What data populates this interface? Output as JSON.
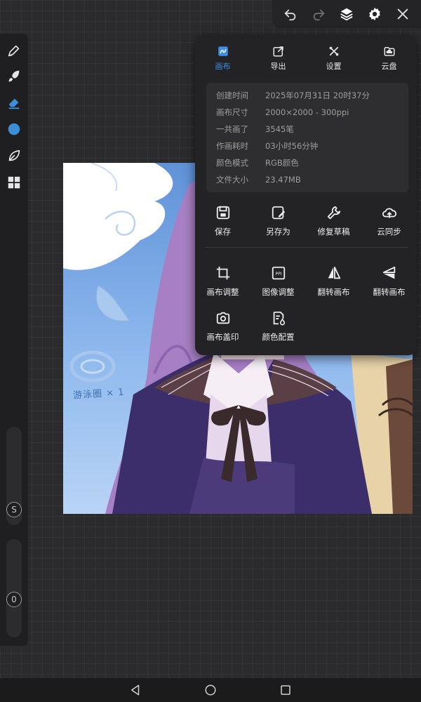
{
  "panel": {
    "tabs": [
      {
        "label": "画布",
        "icon": "canvas-icon",
        "active": true
      },
      {
        "label": "导出",
        "icon": "export-icon",
        "active": false
      },
      {
        "label": "设置",
        "icon": "settings-tools-icon",
        "active": false
      },
      {
        "label": "云盘",
        "icon": "cloud-drive-icon",
        "active": false
      }
    ],
    "info": [
      {
        "key": "创建时间",
        "value": "2025年07月31日 20时37分"
      },
      {
        "key": "画布尺寸",
        "value": "2000×2000 - 300ppi"
      },
      {
        "key": "一共画了",
        "value": "3545笔"
      },
      {
        "key": "作画耗时",
        "value": "03小时56分钟"
      },
      {
        "key": "颜色模式",
        "value": "RGB颜色"
      },
      {
        "key": "文件大小",
        "value": "23.47MB"
      }
    ],
    "actions_row1": [
      {
        "label": "保存",
        "icon": "save-icon"
      },
      {
        "label": "另存为",
        "icon": "save-as-icon"
      },
      {
        "label": "修复草稿",
        "icon": "wrench-icon"
      },
      {
        "label": "云同步",
        "icon": "cloud-sync-icon"
      }
    ],
    "actions_row2": [
      {
        "label": "画布调整",
        "icon": "crop-icon"
      },
      {
        "label": "图像调整",
        "icon": "ppi-icon"
      },
      {
        "label": "翻转画布",
        "icon": "flip-horizontal-icon"
      },
      {
        "label": "翻转画布",
        "icon": "flip-vertical-icon"
      }
    ],
    "actions_row3": [
      {
        "label": "画布盖印",
        "icon": "camera-icon"
      },
      {
        "label": "颜色配置",
        "icon": "color-profile-icon"
      }
    ]
  },
  "left_bar": {
    "slider_size_label": "S",
    "slider_opacity_label": "0",
    "color_swatch": "#3a8fd6"
  },
  "canvas": {
    "watermark": "游泳圈 × 1"
  },
  "colors": {
    "accent": "#3d8fe6",
    "panel_bg": "#232325",
    "workspace_bg": "#2b2b2d"
  }
}
